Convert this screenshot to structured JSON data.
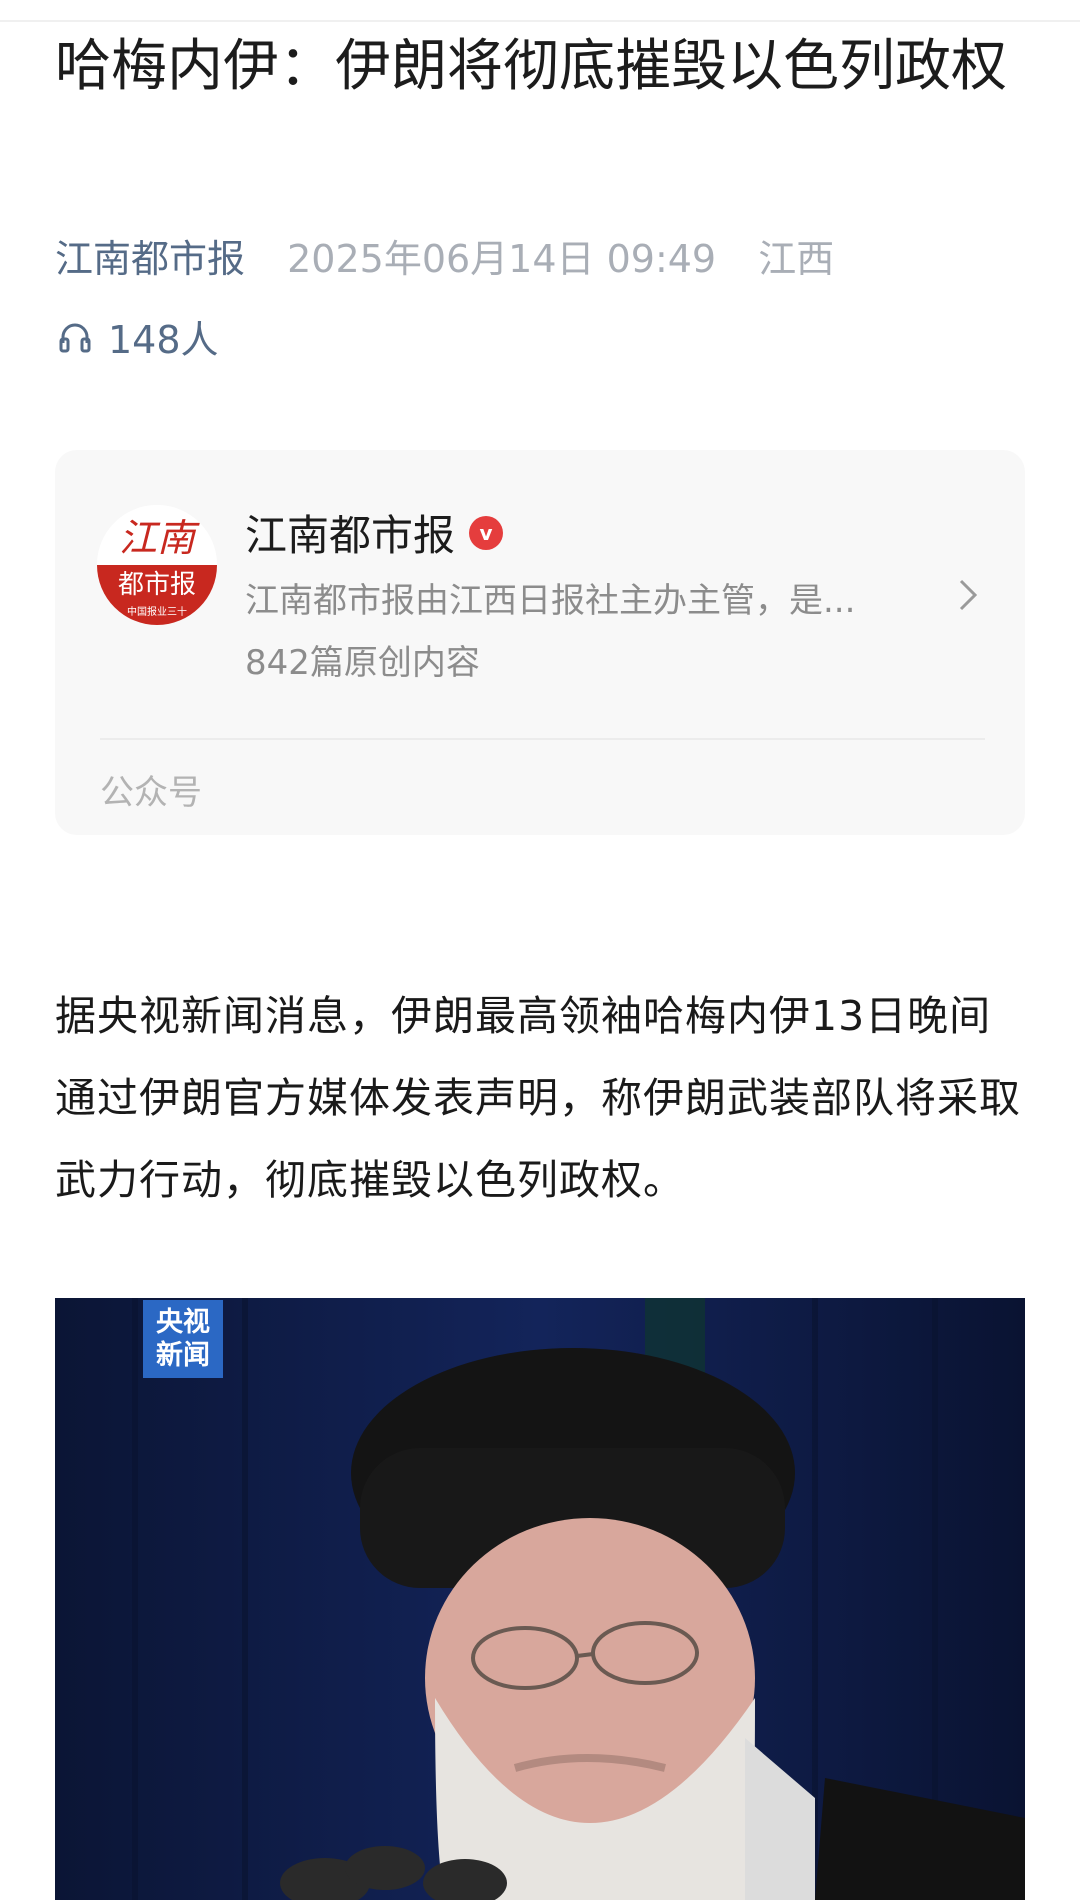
{
  "article": {
    "title": "哈梅内伊：伊朗将彻底摧毁以色列政权",
    "source": "江南都市报",
    "date": "2025年06月14日 09:49",
    "region": "江西",
    "listeners": "148人"
  },
  "account_card": {
    "name": "江南都市报",
    "verified_badge": "v",
    "description": "江南都市报由江西日报社主办主管，是...",
    "article_count": "842篇原创内容",
    "footer_label": "公众号",
    "avatar_text_top": "江南",
    "avatar_text_mid": "都市报",
    "avatar_text_small": "中国报业三十"
  },
  "body": {
    "paragraph": "据央视新闻消息，伊朗最高领袖哈梅内伊13日晚间通过伊朗官方媒体发表声明，称伊朗武装部队将采取武力行动，彻底摧毁以色列政权。"
  },
  "image": {
    "logo_line1": "央视",
    "logo_line2": "新闻"
  },
  "colors": {
    "source_link": "#556b87",
    "meta_gray": "#a9aeb6",
    "verified_red": "#e53d3d",
    "card_bg": "#f8f8f8",
    "cctv_blue": "#2b68c4"
  }
}
